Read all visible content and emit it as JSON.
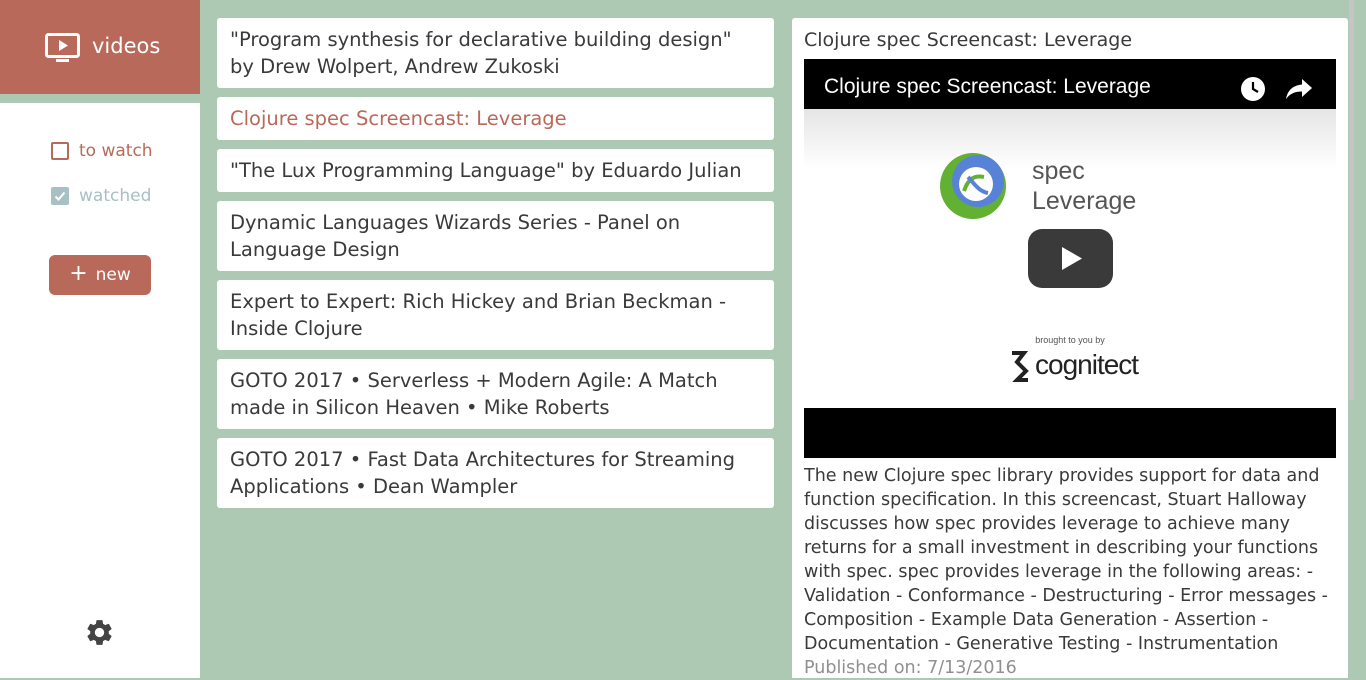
{
  "app": {
    "title": "videos"
  },
  "sidebar": {
    "filters": [
      {
        "label": "to watch",
        "checked": false
      },
      {
        "label": "watched",
        "checked": true
      }
    ],
    "new_label": "new"
  },
  "videos": [
    {
      "title": "\"Program synthesis for declarative building design\" by Drew Wolpert, Andrew Zukoski",
      "selected": false
    },
    {
      "title": "Clojure spec Screencast: Leverage",
      "selected": true
    },
    {
      "title": "\"The Lux Programming Language\" by Eduardo Julian",
      "selected": false
    },
    {
      "title": "Dynamic Languages Wizards Series - Panel on Language Design",
      "selected": false
    },
    {
      "title": "Expert to Expert: Rich Hickey and Brian Beckman - Inside Clojure",
      "selected": false
    },
    {
      "title": "GOTO 2017 • Serverless + Modern Agile: A Match made in Silicon Heaven • Mike Roberts",
      "selected": false
    },
    {
      "title": "GOTO 2017 • Fast Data Architectures for Streaming Applications • Dean Wampler",
      "selected": false
    }
  ],
  "detail": {
    "title": "Clojure spec Screencast: Leverage",
    "player": {
      "title": "Clojure spec Screencast: Leverage",
      "thumb_line1": "spec",
      "thumb_line2": "Leverage",
      "brought_by": "brought to you by",
      "sponsor": "cognitect"
    },
    "description": "The new Clojure spec library provides support for data and function specification. In this screencast, Stuart Halloway discusses how spec provides leverage to achieve many returns for a small investment in describing your functions with spec. spec provides leverage in the following areas: - Validation - Conformance - Destructuring - Error messages - Composition - Example Data Generation - Assertion - Documentation - Generative Testing - Instrumentation",
    "published": "Published on: 7/13/2016"
  },
  "colors": {
    "accent": "#b9695a",
    "background": "#adc9b3",
    "muted": "#a8bfc4"
  }
}
